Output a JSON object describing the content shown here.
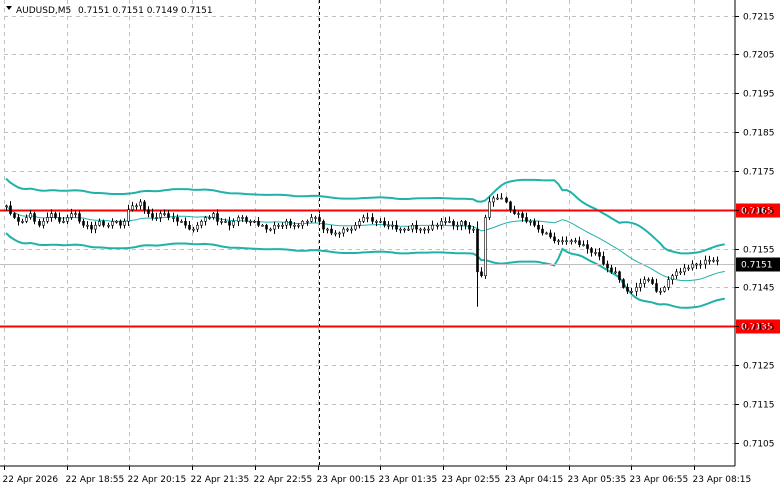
{
  "header": {
    "symbol": "AUDUSD,M5",
    "ohlc": "0.7151 0.7151 0.7149 0.7151"
  },
  "colors": {
    "candle": "#000000",
    "band": "#20b2aa",
    "level_line": "#ff0000",
    "level_tag_bg": "#ff0000",
    "price_tag_bg": "#000000",
    "grid": "#c0c0c0"
  },
  "chart_data": {
    "type": "candlestick",
    "y_ticks": [
      "0.7215",
      "0.7205",
      "0.7195",
      "0.7185",
      "0.7175",
      "0.7165",
      "0.7155",
      "0.7145",
      "0.7135",
      "0.7125",
      "0.7115",
      "0.7105"
    ],
    "ylim": [
      0.7099,
      0.7219
    ],
    "x_ticks": [
      "22 Apr 2026",
      "22 Apr 18:55",
      "22 Apr 20:15",
      "22 Apr 21:35",
      "22 Apr 22:55",
      "23 Apr 00:15",
      "23 Apr 01:35",
      "23 Apr 02:55",
      "23 Apr 04:15",
      "23 Apr 05:35",
      "23 Apr 06:55",
      "23 Apr 08:15"
    ],
    "num_bars": 176,
    "levels": [
      {
        "value": 0.7165,
        "label": "0.7165"
      },
      {
        "value": 0.7135,
        "label": "0.7135"
      }
    ],
    "current_price": {
      "value": 0.7151,
      "label": "0.7151"
    },
    "vertical_marker_bar_index": 77,
    "closes": [
      0.7166,
      0.7164,
      0.7163,
      0.7162,
      0.7162,
      0.7163,
      0.7164,
      0.7162,
      0.7161,
      0.7162,
      0.7163,
      0.7164,
      0.7163,
      0.7162,
      0.7162,
      0.7163,
      0.7164,
      0.7164,
      0.7162,
      0.7161,
      0.7161,
      0.716,
      0.7161,
      0.7162,
      0.7161,
      0.7161,
      0.7162,
      0.7162,
      0.7161,
      0.7162,
      0.7165,
      0.7166,
      0.7166,
      0.7167,
      0.7165,
      0.7164,
      0.7163,
      0.7163,
      0.7164,
      0.7164,
      0.7163,
      0.7163,
      0.7162,
      0.7162,
      0.7161,
      0.716,
      0.716,
      0.7161,
      0.7162,
      0.7163,
      0.7163,
      0.7164,
      0.7162,
      0.7162,
      0.7162,
      0.7161,
      0.7162,
      0.7163,
      0.7163,
      0.7162,
      0.7162,
      0.7162,
      0.7161,
      0.7161,
      0.716,
      0.716,
      0.7161,
      0.7161,
      0.7161,
      0.7162,
      0.7161,
      0.7161,
      0.7161,
      0.7162,
      0.7162,
      0.7163,
      0.7163,
      0.7162,
      0.716,
      0.716,
      0.7159,
      0.7159,
      0.7159,
      0.716,
      0.716,
      0.716,
      0.7161,
      0.7162,
      0.7163,
      0.7163,
      0.7162,
      0.7162,
      0.7162,
      0.7161,
      0.7161,
      0.7161,
      0.716,
      0.716,
      0.716,
      0.716,
      0.7161,
      0.716,
      0.716,
      0.716,
      0.716,
      0.7161,
      0.7161,
      0.7162,
      0.7162,
      0.7162,
      0.7161,
      0.7161,
      0.7162,
      0.7161,
      0.716,
      0.716,
      0.7149,
      0.7148,
      0.7163,
      0.7167,
      0.7168,
      0.7168,
      0.7168,
      0.7167,
      0.7165,
      0.7164,
      0.7164,
      0.7163,
      0.7162,
      0.7162,
      0.7161,
      0.716,
      0.7159,
      0.7159,
      0.7158,
      0.7157,
      0.7157,
      0.7157,
      0.7157,
      0.7157,
      0.7157,
      0.7156,
      0.7156,
      0.7155,
      0.7154,
      0.7154,
      0.7153,
      0.7151,
      0.715,
      0.7149,
      0.7149,
      0.7147,
      0.7145,
      0.7144,
      0.7144,
      0.7145,
      0.7146,
      0.7147,
      0.7147,
      0.7146,
      0.7144,
      0.7144,
      0.7145,
      0.7147,
      0.7148,
      0.7149,
      0.7149,
      0.715,
      0.715,
      0.7151,
      0.7151,
      0.7151,
      0.7152,
      0.7152,
      0.7152,
      0.7152,
      0.7151,
      0.7151
    ]
  }
}
